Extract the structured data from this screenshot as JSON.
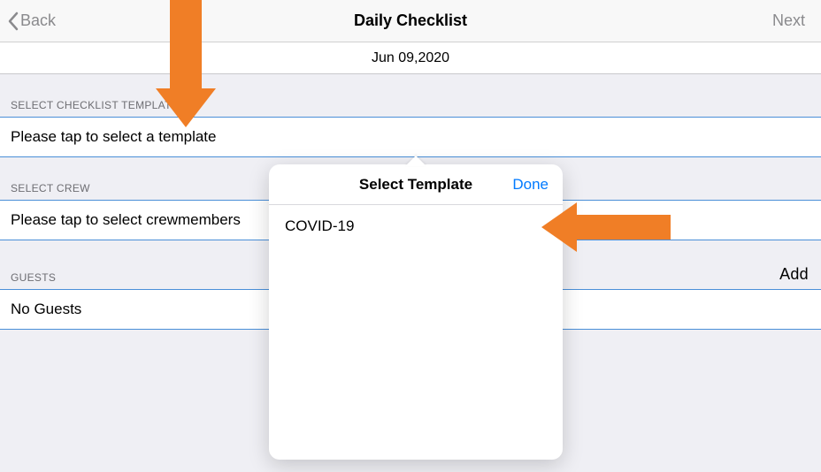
{
  "nav": {
    "back_label": "Back",
    "title": "Daily Checklist",
    "next_label": "Next"
  },
  "date": "Jun 09,2020",
  "sections": {
    "template": {
      "header": "Select Checklist Template",
      "cell": "Please tap to select a template"
    },
    "crew": {
      "header": "Select Crew",
      "cell": "Please tap to select crewmembers"
    },
    "guests": {
      "header": "Guests",
      "add_label": "Add",
      "cell": "No Guests"
    }
  },
  "popover": {
    "title": "Select Template",
    "done_label": "Done",
    "options": [
      "COVID-19"
    ]
  }
}
